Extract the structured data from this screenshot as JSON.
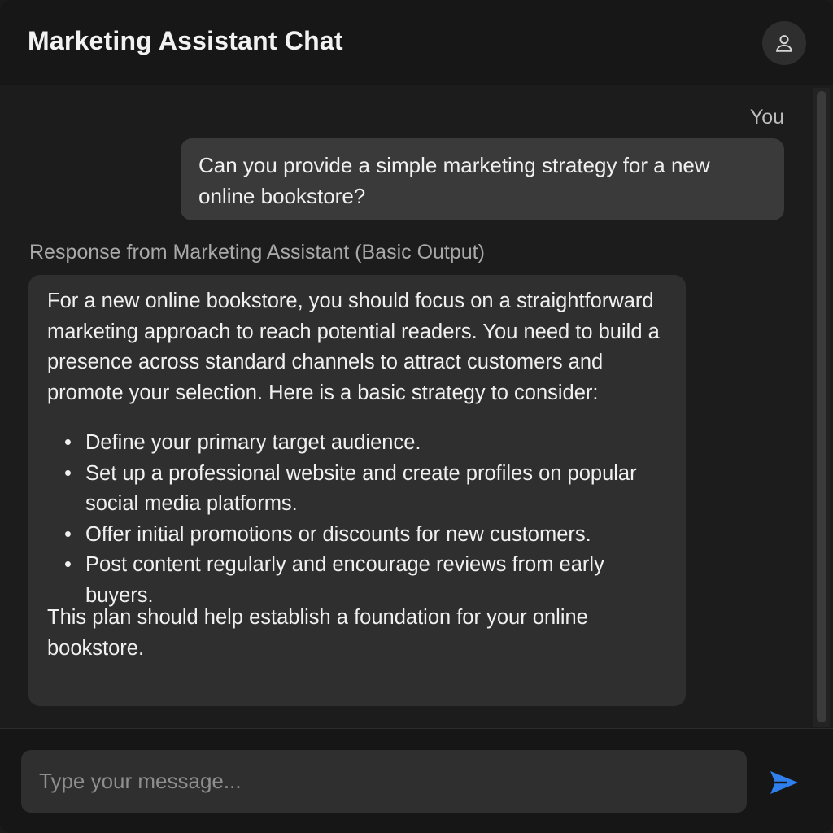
{
  "header": {
    "title": "Marketing Assistant Chat",
    "profile_icon": "user-icon"
  },
  "chat": {
    "user_message": {
      "sender": "You",
      "text": "Can you provide a simple marketing strategy for a new online bookstore?"
    },
    "assistant_message": {
      "label": "Response from Marketing Assistant (Basic Output)",
      "intro": "For a new online bookstore, you should focus on a straightforward marketing approach to reach potential readers. You need to build a presence across standard channels to attract customers and promote your selection. Here is a basic strategy to consider:",
      "items": [
        "Define your primary target audience.",
        "Set up a professional website and create profiles on popular social media platforms.",
        "Offer initial promotions or discounts for new customers.",
        "Post content regularly and encourage reviews from early buyers."
      ],
      "outro": "This plan should help establish a foundation for your online bookstore."
    }
  },
  "composer": {
    "placeholder": "Type your message...",
    "send_icon": "send-icon",
    "accent_color": "#2f80ed"
  }
}
